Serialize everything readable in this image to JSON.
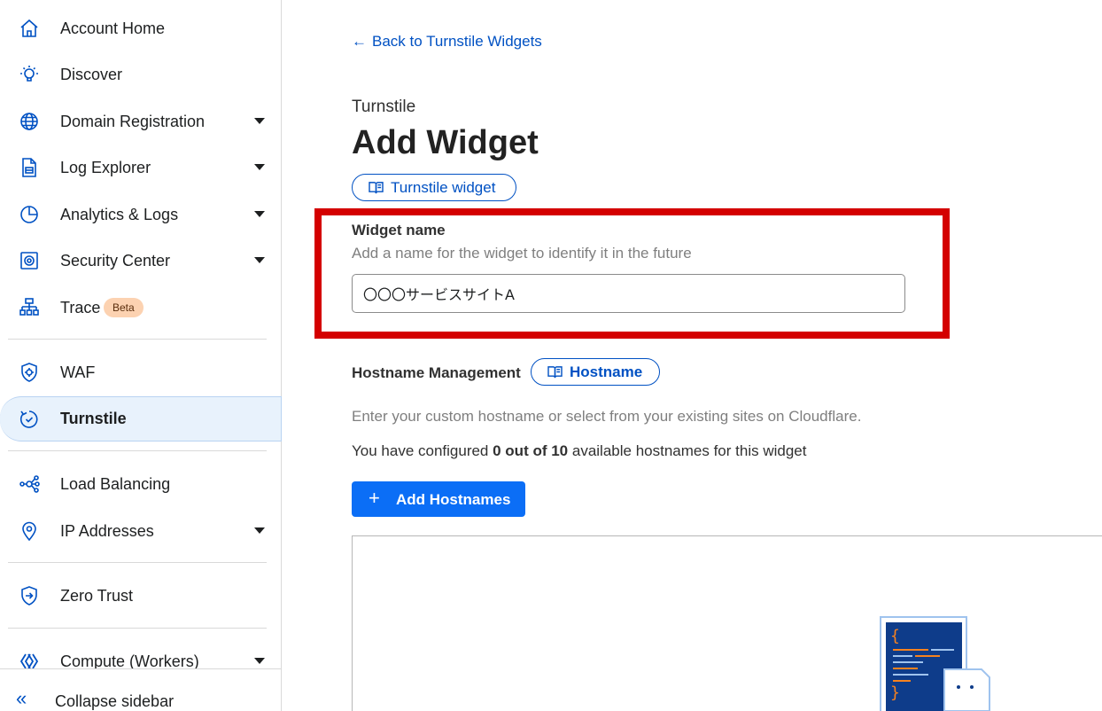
{
  "sidebar": {
    "items": [
      {
        "label": "Account Home",
        "icon": "home-icon",
        "caret": false
      },
      {
        "label": "Discover",
        "icon": "lightbulb-icon",
        "caret": false
      },
      {
        "label": "Domain Registration",
        "icon": "globe-icon",
        "caret": true
      },
      {
        "label": "Log Explorer",
        "icon": "log-document-icon",
        "caret": true
      },
      {
        "label": "Analytics & Logs",
        "icon": "pie-chart-icon",
        "caret": true
      },
      {
        "label": "Security Center",
        "icon": "security-center-icon",
        "caret": true
      },
      {
        "label": "Trace",
        "icon": "trace-icon",
        "caret": false,
        "badge": "Beta"
      },
      {
        "label": "WAF",
        "icon": "waf-shield-icon",
        "caret": false
      },
      {
        "label": "Turnstile",
        "icon": "turnstile-icon",
        "caret": false,
        "active": true
      },
      {
        "label": "Load Balancing",
        "icon": "load-balancing-icon",
        "caret": false
      },
      {
        "label": "IP Addresses",
        "icon": "location-pin-icon",
        "caret": true
      },
      {
        "label": "Zero Trust",
        "icon": "zero-trust-icon",
        "caret": false
      },
      {
        "label": "Compute (Workers)",
        "icon": "workers-icon",
        "caret": true
      }
    ],
    "collapse_label": "Collapse sidebar"
  },
  "main": {
    "back_link": "Back to Turnstile Widgets",
    "eyebrow": "Turnstile",
    "title": "Add Widget",
    "doc_pill": "Turnstile widget",
    "widget_name": {
      "label": "Widget name",
      "help": "Add a name for the widget to identify it in the future",
      "value": "〇〇〇サービスサイトA"
    },
    "hostname": {
      "section_label": "Hostname Management",
      "pill": "Hostname",
      "help": "Enter your custom hostname or select from your existing sites on Cloudflare.",
      "count_prefix": "You have configured",
      "count_bold": "0 out of 10",
      "count_suffix": "available hostnames for this widget",
      "add_button": "Add Hostnames"
    }
  },
  "colors": {
    "accent": "#0051c3",
    "primary_button": "#0b6ef6",
    "highlight_box": "#d40000",
    "beta_badge": "#fcd2b1"
  }
}
